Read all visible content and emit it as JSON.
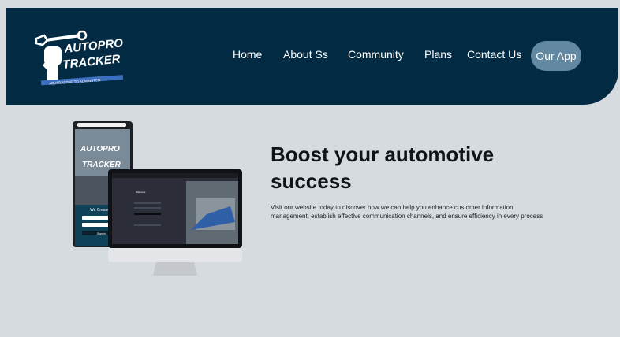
{
  "brand": {
    "logo_line1": "AUTOPRO",
    "logo_line2": "TRACKER",
    "logo_tagline": "ABUTRASTNE TO ADMINSTER"
  },
  "nav": {
    "home": "Home",
    "about": "About Ss",
    "community": "Community",
    "plans": "Plans",
    "contact": "Contact Us",
    "app_button": "Our App"
  },
  "mockup": {
    "phone_welcome": "We Create",
    "phone_button": "Sign in",
    "desktop_welcome": "Welcome"
  },
  "hero": {
    "title": "Boost your automotive success",
    "description": "Visit our website today to discover how we can help you enhance customer information management, establish effective communication channels, and ensure efficiency in every process"
  },
  "colors": {
    "header": "#032c44",
    "accent": "#6388a2",
    "page_bg": "#d6dbe0"
  }
}
